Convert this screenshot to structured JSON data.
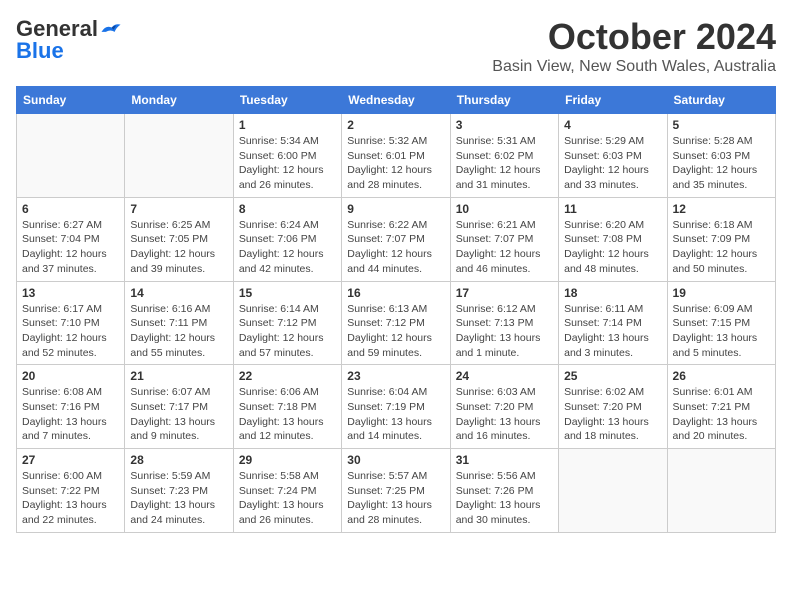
{
  "logo": {
    "general": "General",
    "blue": "Blue"
  },
  "title": "October 2024",
  "location": "Basin View, New South Wales, Australia",
  "days_of_week": [
    "Sunday",
    "Monday",
    "Tuesday",
    "Wednesday",
    "Thursday",
    "Friday",
    "Saturday"
  ],
  "weeks": [
    [
      {
        "day": "",
        "info": ""
      },
      {
        "day": "",
        "info": ""
      },
      {
        "day": "1",
        "info": "Sunrise: 5:34 AM\nSunset: 6:00 PM\nDaylight: 12 hours\nand 26 minutes."
      },
      {
        "day": "2",
        "info": "Sunrise: 5:32 AM\nSunset: 6:01 PM\nDaylight: 12 hours\nand 28 minutes."
      },
      {
        "day": "3",
        "info": "Sunrise: 5:31 AM\nSunset: 6:02 PM\nDaylight: 12 hours\nand 31 minutes."
      },
      {
        "day": "4",
        "info": "Sunrise: 5:29 AM\nSunset: 6:03 PM\nDaylight: 12 hours\nand 33 minutes."
      },
      {
        "day": "5",
        "info": "Sunrise: 5:28 AM\nSunset: 6:03 PM\nDaylight: 12 hours\nand 35 minutes."
      }
    ],
    [
      {
        "day": "6",
        "info": "Sunrise: 6:27 AM\nSunset: 7:04 PM\nDaylight: 12 hours\nand 37 minutes."
      },
      {
        "day": "7",
        "info": "Sunrise: 6:25 AM\nSunset: 7:05 PM\nDaylight: 12 hours\nand 39 minutes."
      },
      {
        "day": "8",
        "info": "Sunrise: 6:24 AM\nSunset: 7:06 PM\nDaylight: 12 hours\nand 42 minutes."
      },
      {
        "day": "9",
        "info": "Sunrise: 6:22 AM\nSunset: 7:07 PM\nDaylight: 12 hours\nand 44 minutes."
      },
      {
        "day": "10",
        "info": "Sunrise: 6:21 AM\nSunset: 7:07 PM\nDaylight: 12 hours\nand 46 minutes."
      },
      {
        "day": "11",
        "info": "Sunrise: 6:20 AM\nSunset: 7:08 PM\nDaylight: 12 hours\nand 48 minutes."
      },
      {
        "day": "12",
        "info": "Sunrise: 6:18 AM\nSunset: 7:09 PM\nDaylight: 12 hours\nand 50 minutes."
      }
    ],
    [
      {
        "day": "13",
        "info": "Sunrise: 6:17 AM\nSunset: 7:10 PM\nDaylight: 12 hours\nand 52 minutes."
      },
      {
        "day": "14",
        "info": "Sunrise: 6:16 AM\nSunset: 7:11 PM\nDaylight: 12 hours\nand 55 minutes."
      },
      {
        "day": "15",
        "info": "Sunrise: 6:14 AM\nSunset: 7:12 PM\nDaylight: 12 hours\nand 57 minutes."
      },
      {
        "day": "16",
        "info": "Sunrise: 6:13 AM\nSunset: 7:12 PM\nDaylight: 12 hours\nand 59 minutes."
      },
      {
        "day": "17",
        "info": "Sunrise: 6:12 AM\nSunset: 7:13 PM\nDaylight: 13 hours\nand 1 minute."
      },
      {
        "day": "18",
        "info": "Sunrise: 6:11 AM\nSunset: 7:14 PM\nDaylight: 13 hours\nand 3 minutes."
      },
      {
        "day": "19",
        "info": "Sunrise: 6:09 AM\nSunset: 7:15 PM\nDaylight: 13 hours\nand 5 minutes."
      }
    ],
    [
      {
        "day": "20",
        "info": "Sunrise: 6:08 AM\nSunset: 7:16 PM\nDaylight: 13 hours\nand 7 minutes."
      },
      {
        "day": "21",
        "info": "Sunrise: 6:07 AM\nSunset: 7:17 PM\nDaylight: 13 hours\nand 9 minutes."
      },
      {
        "day": "22",
        "info": "Sunrise: 6:06 AM\nSunset: 7:18 PM\nDaylight: 13 hours\nand 12 minutes."
      },
      {
        "day": "23",
        "info": "Sunrise: 6:04 AM\nSunset: 7:19 PM\nDaylight: 13 hours\nand 14 minutes."
      },
      {
        "day": "24",
        "info": "Sunrise: 6:03 AM\nSunset: 7:20 PM\nDaylight: 13 hours\nand 16 minutes."
      },
      {
        "day": "25",
        "info": "Sunrise: 6:02 AM\nSunset: 7:20 PM\nDaylight: 13 hours\nand 18 minutes."
      },
      {
        "day": "26",
        "info": "Sunrise: 6:01 AM\nSunset: 7:21 PM\nDaylight: 13 hours\nand 20 minutes."
      }
    ],
    [
      {
        "day": "27",
        "info": "Sunrise: 6:00 AM\nSunset: 7:22 PM\nDaylight: 13 hours\nand 22 minutes."
      },
      {
        "day": "28",
        "info": "Sunrise: 5:59 AM\nSunset: 7:23 PM\nDaylight: 13 hours\nand 24 minutes."
      },
      {
        "day": "29",
        "info": "Sunrise: 5:58 AM\nSunset: 7:24 PM\nDaylight: 13 hours\nand 26 minutes."
      },
      {
        "day": "30",
        "info": "Sunrise: 5:57 AM\nSunset: 7:25 PM\nDaylight: 13 hours\nand 28 minutes."
      },
      {
        "day": "31",
        "info": "Sunrise: 5:56 AM\nSunset: 7:26 PM\nDaylight: 13 hours\nand 30 minutes."
      },
      {
        "day": "",
        "info": ""
      },
      {
        "day": "",
        "info": ""
      }
    ]
  ]
}
